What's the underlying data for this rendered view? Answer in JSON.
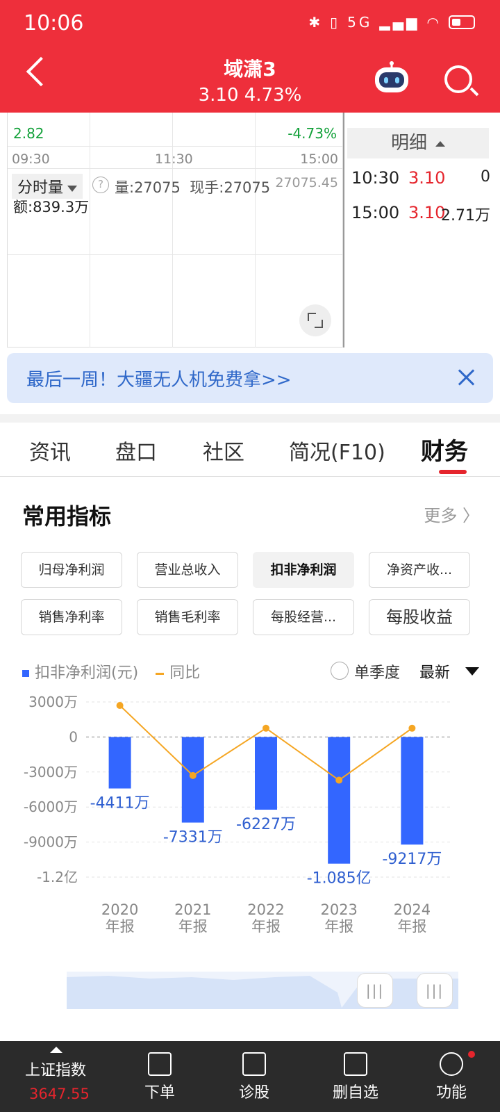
{
  "status_bar": {
    "time": "10:06",
    "network": "5G"
  },
  "header": {
    "name": "域潇3",
    "price_line": "3.10 4.73%"
  },
  "intraday": {
    "low_price": "2.82",
    "low_pct": "-4.73%",
    "times": [
      "09:30",
      "11:30",
      "15:00"
    ],
    "volume_selector": "分时量",
    "amount": "额:839.3万",
    "volume": "量:27075",
    "current_hand": "现手:27075",
    "volume_max": "27075.45"
  },
  "detail": {
    "title": "明细",
    "rows": [
      {
        "time": "10:30",
        "price": "3.10",
        "vol": "0"
      },
      {
        "time": "15:00",
        "price": "3.10",
        "vol": "2.71万"
      }
    ]
  },
  "banner": {
    "text": "最后一周！大疆无人机免费拿>>"
  },
  "tabs": [
    "资讯",
    "盘口",
    "社区",
    "简况(F10)",
    "财务"
  ],
  "active_tab": "财务",
  "section": {
    "title": "常用指标",
    "more": "更多 〉"
  },
  "chips": [
    "归母净利润",
    "营业总收入",
    "扣非净利润",
    "净资产收...",
    "销售净利率",
    "销售毛利率",
    "每股经营...",
    "每股收益"
  ],
  "legend": {
    "bar": "扣非净利润(元)",
    "line": "同比",
    "single_quarter": "单季度",
    "latest": "最新"
  },
  "colors": {
    "header": "#ee2f3b",
    "bar": "#3366ff",
    "line": "#f5a623",
    "up": "#e5252d",
    "down": "#13a13a"
  },
  "chart_data": {
    "type": "bar",
    "categories": [
      "2020\n年报",
      "2021\n年报",
      "2022\n年报",
      "2023\n年报",
      "2024\n年报"
    ],
    "category_years": [
      "2020",
      "2021",
      "2022",
      "2023",
      "2024"
    ],
    "category_suffix": "年报",
    "series": [
      {
        "name": "扣非净利润(元)",
        "type": "bar",
        "values": [
          -4411,
          -7331,
          -6227,
          -10850,
          -9217
        ],
        "unit": "万",
        "labels": [
          "-4411万",
          "-7331万",
          "-6227万",
          "-1.085亿",
          "-9217万"
        ]
      },
      {
        "name": "同比",
        "type": "line",
        "values": [
          2700,
          -3300,
          750,
          -3700,
          750
        ],
        "unit": "万"
      }
    ],
    "ytick_labels": [
      "3000万",
      "0",
      "-3000万",
      "-6000万",
      "-9000万",
      "-1.2亿"
    ],
    "ytick_values": [
      3000,
      0,
      -3000,
      -6000,
      -9000,
      -12000
    ],
    "ylim": [
      -12000,
      3000
    ],
    "grid": true
  },
  "bottom_nav": {
    "index_name": "上证指数",
    "index_value": "3647.55",
    "items": [
      "下单",
      "诊股",
      "删自选",
      "功能"
    ]
  }
}
